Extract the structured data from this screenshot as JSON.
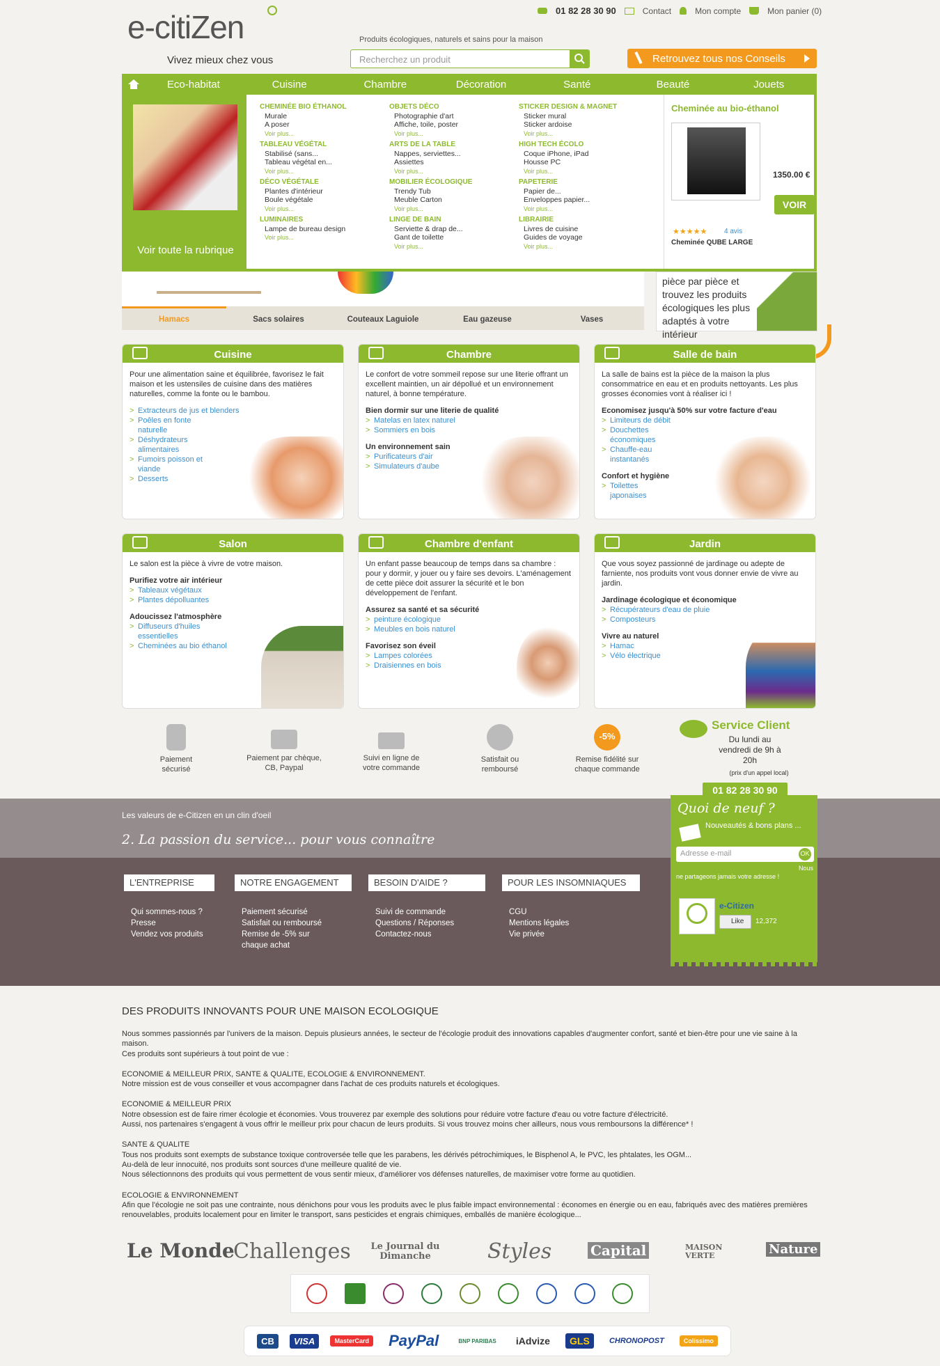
{
  "header": {
    "phone": "01 82 28 30 90",
    "contact": "Contact",
    "account": "Mon compte",
    "cart": "Mon panier (0)",
    "logo": "e-citiZen",
    "tagline": "Vivez mieux chez vous",
    "slogan": "Produits écologiques, naturels et sains pour la maison",
    "search_placeholder": "Recherchez un produit",
    "conseils": "Retrouvez tous nos Conseils"
  },
  "nav": [
    "Eco-habitat",
    "Cuisine",
    "Chambre",
    "Décoration",
    "Santé",
    "Beauté",
    "Jouets"
  ],
  "mega": {
    "left_label": "Voir toute la rubrique",
    "more": "Voir plus...",
    "columns": [
      [
        {
          "title": "CHEMINÉE BIO ÉTHANOL",
          "items": [
            "Murale",
            "A poser"
          ]
        },
        {
          "title": "TABLEAU VÉGÉTAL",
          "items": [
            "Stabilisé (sans...",
            "Tableau végétal en..."
          ]
        },
        {
          "title": "DÉCO VÉGÉTALE",
          "items": [
            "Plantes d'intérieur",
            "Boule végétale"
          ]
        },
        {
          "title": "LUMINAIRES",
          "items": [
            "Lampe de bureau design"
          ]
        }
      ],
      [
        {
          "title": "OBJETS DÉCO",
          "items": [
            "Photographie d'art",
            "Affiche, toile, poster"
          ]
        },
        {
          "title": "ARTS DE LA TABLE",
          "items": [
            "Nappes, serviettes...",
            "Assiettes"
          ]
        },
        {
          "title": "MOBILIER ÉCOLOGIQUE",
          "items": [
            "Trendy Tub",
            "Meuble Carton"
          ]
        },
        {
          "title": "LINGE DE BAIN",
          "items": [
            "Serviette & drap de...",
            "Gant de toilette"
          ]
        }
      ],
      [
        {
          "title": "STICKER DESIGN & MAGNET",
          "items": [
            "Sticker mural",
            "Sticker ardoise"
          ]
        },
        {
          "title": "HIGH TECH ÉCOLO",
          "items": [
            "Coque iPhone, iPad",
            "Housse PC"
          ]
        },
        {
          "title": "PAPETERIE",
          "items": [
            "Papier de...",
            "Enveloppes papier..."
          ]
        },
        {
          "title": "LIBRAIRIE",
          "items": [
            "Livres de cuisine",
            "Guides de voyage"
          ]
        }
      ]
    ],
    "featured": {
      "title": "Cheminée au bio-éthanol",
      "price": "1350.00 €",
      "button": "VOIR",
      "stars": "★★★★★",
      "reviews": "4 avis",
      "name": "Cheminée QUBE LARGE"
    }
  },
  "hero_tabs": [
    "Hamacs",
    "Sacs solaires",
    "Couteaux Laguiole",
    "Eau gazeuse",
    "Vases"
  ],
  "side_box": "pièce par pièce et trouvez les produits écologiques les plus adaptés à votre intérieur",
  "cards": [
    {
      "title": "Cuisine",
      "intro": "Pour une alimentation saine et équilibrée, favorisez le fait maison et les ustensiles de cuisine dans des matières naturelles, comme la fonte ou le bambou.",
      "groups": [
        {
          "head": "",
          "links": [
            "Extracteurs de jus et blenders",
            "Poêles en fonte naturelle",
            "Déshydrateurs alimentaires",
            "Fumoirs poisson et viande",
            "Desserts"
          ]
        }
      ]
    },
    {
      "title": "Chambre",
      "intro": "Le confort de votre sommeil repose sur une literie offrant un excellent maintien, un air dépollué et un environnement naturel, à bonne température.",
      "groups": [
        {
          "head": "Bien dormir sur une literie de qualité",
          "links": [
            "Matelas en latex naturel",
            "Sommiers en bois"
          ]
        },
        {
          "head": "Un environnement sain",
          "links": [
            "Purificateurs d'air",
            "Simulateurs d'aube"
          ]
        }
      ]
    },
    {
      "title": "Salle de bain",
      "intro": "La salle de bains est la pièce de la maison la plus consommatrice en eau et en produits nettoyants. Les plus grosses économies vont à réaliser ici !",
      "groups": [
        {
          "head": "Economisez jusqu'à 50% sur votre facture d'eau",
          "links": [
            "Limiteurs de débit",
            "Douchettes économiques",
            "Chauffe-eau instantanés"
          ]
        },
        {
          "head": "Confort et hygiène",
          "links": [
            "Toilettes japonaises"
          ]
        }
      ]
    },
    {
      "title": "Salon",
      "intro": "Le salon est la pièce à vivre de votre maison.",
      "groups": [
        {
          "head": "Purifiez votre air intérieur",
          "links": [
            "Tableaux végétaux",
            "Plantes dépolluantes"
          ]
        },
        {
          "head": "Adoucissez l'atmosphère",
          "links": [
            "Diffuseurs d'huiles essentielles",
            "Cheminées au bio éthanol"
          ]
        }
      ]
    },
    {
      "title": "Chambre d'enfant",
      "intro": "Un enfant passe beaucoup de temps dans sa chambre : pour y dormir, y jouer ou y faire ses devoirs. L'aménagement de cette pièce doit assurer la sécurité et le bon développement de l'enfant.",
      "groups": [
        {
          "head": "Assurez sa santé et sa sécurité",
          "links": [
            "peinture écologique",
            "Meubles en bois naturel"
          ]
        },
        {
          "head": "Favorisez son éveil",
          "links": [
            "Lampes colorées",
            "Draisiennes en bois"
          ]
        }
      ]
    },
    {
      "title": "Jardin",
      "intro": "Que vous soyez passionné de jardinage ou adepte de farniente, nos produits vont vous donner envie de vivre au jardin.",
      "groups": [
        {
          "head": "Jardinage écologique et économique",
          "links": [
            "Récupérateurs d'eau de pluie",
            "Composteurs"
          ]
        },
        {
          "head": "Vivre au naturel",
          "links": [
            "Hamac",
            "Vélo électrique"
          ]
        }
      ]
    }
  ],
  "services": [
    {
      "label": "Paiement sécurisé"
    },
    {
      "label": "Paiement par chèque, CB, Paypal"
    },
    {
      "label": "Suivi en ligne de votre commande"
    },
    {
      "label": "Satisfait ou remboursé"
    },
    {
      "label": "Remise fidélité sur chaque commande",
      "badge": "-5%"
    }
  ],
  "service_client": {
    "title": "Service Client",
    "hours": "Du lundi au vendredi de 9h à 20h",
    "note": "(prix d'un appel local)",
    "phone": "01 82 28 30 90"
  },
  "values": {
    "title": "Les valeurs de e-Citizen en un clin d'oeil",
    "headline": "2. La passion du service... pour vous connaître"
  },
  "footer_cols": [
    {
      "title": "L'ENTREPRISE",
      "links": [
        "Qui sommes-nous ?",
        "Presse",
        "Vendez vos produits"
      ]
    },
    {
      "title": "NOTRE ENGAGEMENT",
      "links": [
        "Paiement sécurisé",
        "Satisfait ou remboursé",
        "Remise de -5% sur chaque achat"
      ]
    },
    {
      "title": "BESOIN D'AIDE ?",
      "links": [
        "Suivi de commande",
        "Questions / Réponses",
        "Contactez-nous"
      ]
    },
    {
      "title": "POUR LES INSOMNIAQUES",
      "links": [
        "CGU",
        "Mentions légales",
        "Vie privée"
      ]
    }
  ],
  "newsletter": {
    "title": "Quoi de neuf ?",
    "sub": "Nouveautés & bons plans ...",
    "placeholder": "Adresse e-mail",
    "ok": "OK",
    "nous": "Nous",
    "partage": "ne partageons jamais votre adresse !",
    "fb_name": "e-Citizen",
    "like": "Like",
    "count": "12,372"
  },
  "seo": {
    "title": "DES PRODUITS INNOVANTS POUR UNE MAISON ECOLOGIQUE",
    "p1": "Nous sommes passionnés par l'univers de la maison. Depuis plusieurs années, le secteur de l'écologie produit des innovations capables d'augmenter confort, santé et bien-être pour une vie saine à la maison.",
    "p1b": "Ces produits sont supérieurs à tout point de vue :",
    "p2": "ECONOMIE & MEILLEUR PRIX, SANTE & QUALITE, ECOLOGIE & ENVIRONNEMENT.",
    "p2b": "Notre mission est de vous conseiller et vous accompagner dans l'achat de ces produits naturels et écologiques.",
    "h3": "ECONOMIE & MEILLEUR PRIX",
    "p3": "Notre obsession est de faire rimer écologie et économies. Vous trouverez par exemple des solutions pour réduire votre facture d'eau ou votre facture d'électricité.",
    "p3b": "Aussi, nos partenaires s'engagent à vous offrir le meilleur prix pour chacun de leurs produits. Si vous trouvez moins cher ailleurs, nous vous remboursons la différence* !",
    "h4": "SANTE & QUALITE",
    "p4": "Tous nos produits sont exempts de substance toxique controversée telle que les parabens, les dérivés pétrochimiques, le Bisphenol A, le PVC, les phtalates, les OGM...",
    "p4b": "Au-delà de leur innocuité, nos produits sont sources d'une meilleure qualité de vie.",
    "p4c": "Nous sélectionnons des produits qui vous permettent de vous sentir mieux, d'améliorer vos défenses naturelles, de maximiser votre forme au quotidien.",
    "h5": "ECOLOGIE & ENVIRONNEMENT",
    "p5": "Afin que l'écologie ne soit pas une contrainte, nous dénichons pour vous les produits avec le plus faible impact environnemental : économes en énergie ou en eau, fabriqués avec des matières premières renouvelables, produits localement pour en limiter le transport, sans pesticides et engrais chimiques, emballés de manière écologique..."
  },
  "press": [
    "Le Monde",
    "Challenges",
    "Le Journal du Dimanche",
    "Styles",
    "Capital",
    "MAISON VERTE",
    "Nature"
  ],
  "payments": [
    "CB",
    "VISA",
    "MasterCard",
    "PayPal",
    "BNP PARIBAS",
    "iAdvize",
    "GLS",
    "CHRONOPOST",
    "Colissimo"
  ]
}
